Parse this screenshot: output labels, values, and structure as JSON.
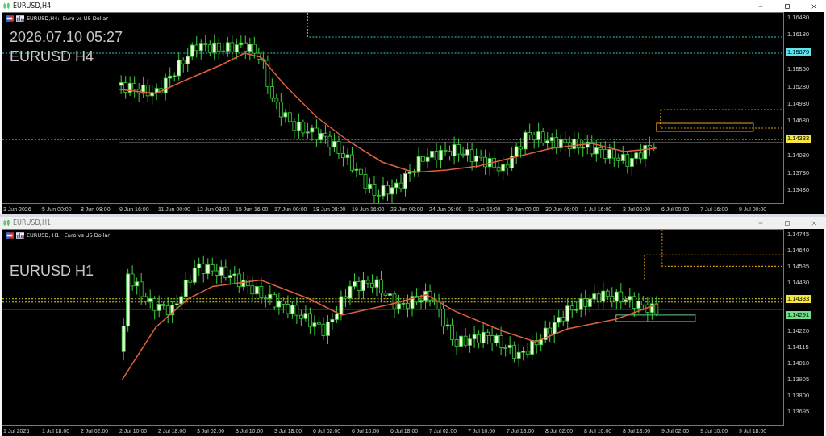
{
  "windows": [
    {
      "title": "EURUSD,H4",
      "active": true,
      "chart_header": "EURUSD,H4:  Euro vs US Dollar",
      "overlay_texts": [
        "2026.07.10 05:27",
        "EURUSD H4"
      ],
      "price_axis": [
        {
          "kind": "label",
          "text": "1.16480"
        },
        {
          "kind": "label",
          "text": "1.16180"
        },
        {
          "kind": "tag",
          "text": "1.15879",
          "color": "#5ee6f0"
        },
        {
          "kind": "label",
          "text": "1.15580"
        },
        {
          "kind": "label",
          "text": "1.15280"
        },
        {
          "kind": "label",
          "text": "1.14980"
        },
        {
          "kind": "label",
          "text": "1.14680"
        },
        {
          "kind": "tag",
          "text": "1.14333",
          "color": "#f5e642"
        },
        {
          "kind": "label",
          "text": "1.14080"
        },
        {
          "kind": "label",
          "text": "1.13780"
        },
        {
          "kind": "label",
          "text": "1.13480"
        }
      ],
      "time_labels": [
        "3 Jun 2026",
        "5 Jun 00:00",
        "8 Jun 08:00",
        "9 Jun 16:00",
        "11 Jun 00:00",
        "12 Jun 08:00",
        "15 Jun 16:00",
        "17 Jun 00:00",
        "18 Jun 08:00",
        "19 Jun 16:00",
        "23 Jun 00:00",
        "24 Jun 08:00",
        "25 Jun 16:00",
        "29 Jun 00:00",
        "30 Jun 08:00",
        "1 Jul 16:00",
        "3 Jul 00:00",
        "6 Jul 00:00",
        "7 Jul 16:00",
        "9 Jul 00:00"
      ]
    },
    {
      "title": "EURUSD,H1",
      "active": false,
      "chart_header": "EURUSD, H1:  Euro vs US Dollar",
      "overlay_texts": [
        "EURUSD H1"
      ],
      "price_axis": [
        {
          "kind": "label",
          "text": "1.14745"
        },
        {
          "kind": "label",
          "text": "1.14640"
        },
        {
          "kind": "label",
          "text": "1.14535"
        },
        {
          "kind": "label",
          "text": "1.14430"
        },
        {
          "kind": "tag",
          "text": "1.14333",
          "color": "#f5e642"
        },
        {
          "kind": "tag",
          "text": "1.14291",
          "color": "#6fe08a"
        },
        {
          "kind": "label",
          "text": "1.14220"
        },
        {
          "kind": "label",
          "text": "1.14115"
        },
        {
          "kind": "label",
          "text": "1.14010"
        },
        {
          "kind": "label",
          "text": "1.13905"
        },
        {
          "kind": "label",
          "text": "1.13800"
        },
        {
          "kind": "label",
          "text": "1.13695"
        }
      ],
      "time_labels": [
        "1 Jul 2026",
        "1 Jul 18:00",
        "2 Jul 02:00",
        "2 Jul 10:00",
        "2 Jul 18:00",
        "3 Jul 02:00",
        "3 Jul 10:00",
        "3 Jul 18:00",
        "6 Jul 02:00",
        "6 Jul 10:00",
        "6 Jul 18:00",
        "7 Jul 02:00",
        "7 Jul 10:00",
        "7 Jul 18:00",
        "8 Jul 02:00",
        "8 Jul 10:00",
        "8 Jul 18:00",
        "9 Jul 02:00",
        "9 Jul 10:00",
        "9 Jul 18:00"
      ]
    }
  ]
}
